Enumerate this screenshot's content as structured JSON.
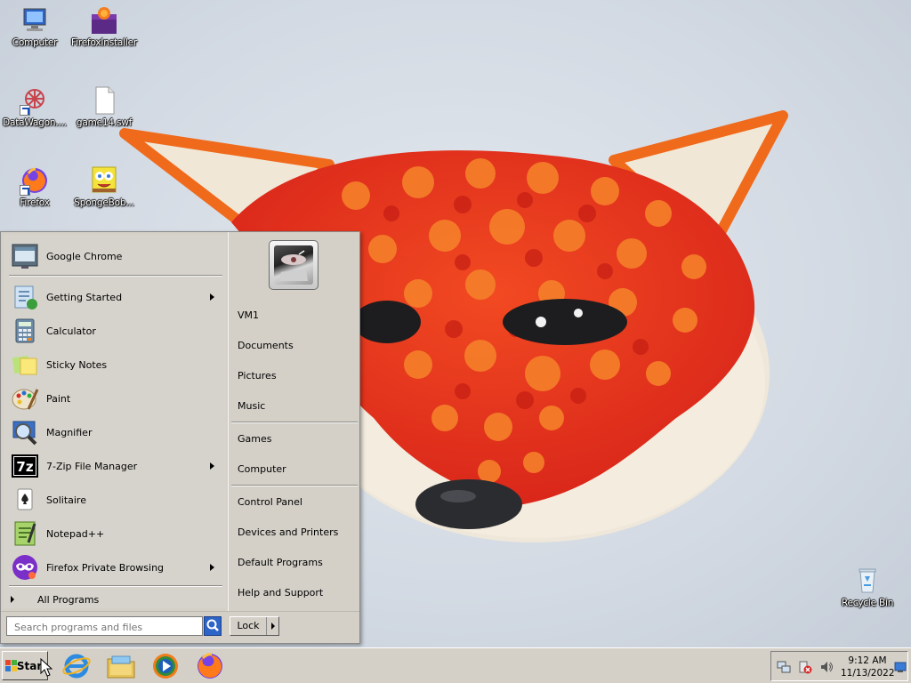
{
  "desktop": {
    "icons": [
      {
        "label": "Computer",
        "icon": "computer-icon"
      },
      {
        "label": "FirefoxInstaller",
        "icon": "installer-box-icon"
      },
      {
        "label": "DataWagon....",
        "icon": "datawagon-icon"
      },
      {
        "label": "game14.swf",
        "icon": "file-icon"
      },
      {
        "label": "Firefox",
        "icon": "firefox-icon"
      },
      {
        "label": "SpongeBob...",
        "icon": "spongebob-icon"
      },
      {
        "label": "Recycle Bin",
        "icon": "recycle-bin-icon"
      }
    ]
  },
  "start_menu": {
    "pinned": {
      "label": "Google Chrome",
      "icon": "chrome-icon"
    },
    "programs": [
      {
        "label": "Getting Started",
        "icon": "getting-started-icon",
        "submenu": true
      },
      {
        "label": "Calculator",
        "icon": "calculator-icon",
        "submenu": false
      },
      {
        "label": "Sticky Notes",
        "icon": "sticky-notes-icon",
        "submenu": false
      },
      {
        "label": "Paint",
        "icon": "paint-icon",
        "submenu": false
      },
      {
        "label": "Magnifier",
        "icon": "magnifier-icon",
        "submenu": false
      },
      {
        "label": "7-Zip File Manager",
        "icon": "seven-zip-icon",
        "submenu": true
      },
      {
        "label": "Solitaire",
        "icon": "solitaire-icon",
        "submenu": false
      },
      {
        "label": "Notepad++",
        "icon": "notepad-plus-plus-icon",
        "submenu": false
      },
      {
        "label": "Firefox Private Browsing",
        "icon": "firefox-private-icon",
        "submenu": true
      }
    ],
    "all_programs": "All Programs",
    "right_items": [
      {
        "label": "VM1"
      },
      {
        "label": "Documents"
      },
      {
        "label": "Pictures"
      },
      {
        "label": "Music"
      },
      {
        "label": "Games"
      },
      {
        "label": "Computer"
      },
      {
        "label": "Control Panel"
      },
      {
        "label": "Devices and Printers"
      },
      {
        "label": "Default Programs"
      },
      {
        "label": "Help and Support"
      }
    ],
    "search_placeholder": "Search programs and files",
    "lock_label": "Lock"
  },
  "taskbar": {
    "start_label": "Start",
    "pinned": [
      "internet-explorer-icon",
      "file-explorer-icon",
      "media-player-icon",
      "firefox-icon"
    ],
    "tray_icons": [
      "network-icon",
      "action-center-icon",
      "volume-icon"
    ],
    "time": "9:12 AM",
    "date": "11/13/2022"
  },
  "colors": {
    "menu_bg": "#d4d0c8",
    "accent_blue": "#2d64c8",
    "fox_red": "#e8391c",
    "fox_orange": "#f26a1b",
    "cream": "#f1eadc"
  }
}
